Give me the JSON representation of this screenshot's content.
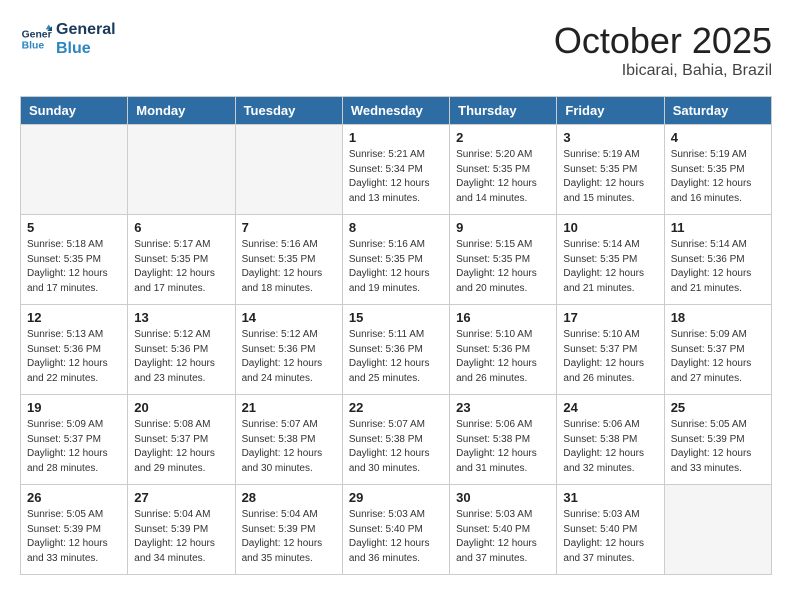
{
  "header": {
    "logo_line1": "General",
    "logo_line2": "Blue",
    "month": "October 2025",
    "location": "Ibicarai, Bahia, Brazil"
  },
  "days_of_week": [
    "Sunday",
    "Monday",
    "Tuesday",
    "Wednesday",
    "Thursday",
    "Friday",
    "Saturday"
  ],
  "weeks": [
    [
      {
        "day": "",
        "info": ""
      },
      {
        "day": "",
        "info": ""
      },
      {
        "day": "",
        "info": ""
      },
      {
        "day": "1",
        "info": "Sunrise: 5:21 AM\nSunset: 5:34 PM\nDaylight: 12 hours\nand 13 minutes."
      },
      {
        "day": "2",
        "info": "Sunrise: 5:20 AM\nSunset: 5:35 PM\nDaylight: 12 hours\nand 14 minutes."
      },
      {
        "day": "3",
        "info": "Sunrise: 5:19 AM\nSunset: 5:35 PM\nDaylight: 12 hours\nand 15 minutes."
      },
      {
        "day": "4",
        "info": "Sunrise: 5:19 AM\nSunset: 5:35 PM\nDaylight: 12 hours\nand 16 minutes."
      }
    ],
    [
      {
        "day": "5",
        "info": "Sunrise: 5:18 AM\nSunset: 5:35 PM\nDaylight: 12 hours\nand 17 minutes."
      },
      {
        "day": "6",
        "info": "Sunrise: 5:17 AM\nSunset: 5:35 PM\nDaylight: 12 hours\nand 17 minutes."
      },
      {
        "day": "7",
        "info": "Sunrise: 5:16 AM\nSunset: 5:35 PM\nDaylight: 12 hours\nand 18 minutes."
      },
      {
        "day": "8",
        "info": "Sunrise: 5:16 AM\nSunset: 5:35 PM\nDaylight: 12 hours\nand 19 minutes."
      },
      {
        "day": "9",
        "info": "Sunrise: 5:15 AM\nSunset: 5:35 PM\nDaylight: 12 hours\nand 20 minutes."
      },
      {
        "day": "10",
        "info": "Sunrise: 5:14 AM\nSunset: 5:35 PM\nDaylight: 12 hours\nand 21 minutes."
      },
      {
        "day": "11",
        "info": "Sunrise: 5:14 AM\nSunset: 5:36 PM\nDaylight: 12 hours\nand 21 minutes."
      }
    ],
    [
      {
        "day": "12",
        "info": "Sunrise: 5:13 AM\nSunset: 5:36 PM\nDaylight: 12 hours\nand 22 minutes."
      },
      {
        "day": "13",
        "info": "Sunrise: 5:12 AM\nSunset: 5:36 PM\nDaylight: 12 hours\nand 23 minutes."
      },
      {
        "day": "14",
        "info": "Sunrise: 5:12 AM\nSunset: 5:36 PM\nDaylight: 12 hours\nand 24 minutes."
      },
      {
        "day": "15",
        "info": "Sunrise: 5:11 AM\nSunset: 5:36 PM\nDaylight: 12 hours\nand 25 minutes."
      },
      {
        "day": "16",
        "info": "Sunrise: 5:10 AM\nSunset: 5:36 PM\nDaylight: 12 hours\nand 26 minutes."
      },
      {
        "day": "17",
        "info": "Sunrise: 5:10 AM\nSunset: 5:37 PM\nDaylight: 12 hours\nand 26 minutes."
      },
      {
        "day": "18",
        "info": "Sunrise: 5:09 AM\nSunset: 5:37 PM\nDaylight: 12 hours\nand 27 minutes."
      }
    ],
    [
      {
        "day": "19",
        "info": "Sunrise: 5:09 AM\nSunset: 5:37 PM\nDaylight: 12 hours\nand 28 minutes."
      },
      {
        "day": "20",
        "info": "Sunrise: 5:08 AM\nSunset: 5:37 PM\nDaylight: 12 hours\nand 29 minutes."
      },
      {
        "day": "21",
        "info": "Sunrise: 5:07 AM\nSunset: 5:38 PM\nDaylight: 12 hours\nand 30 minutes."
      },
      {
        "day": "22",
        "info": "Sunrise: 5:07 AM\nSunset: 5:38 PM\nDaylight: 12 hours\nand 30 minutes."
      },
      {
        "day": "23",
        "info": "Sunrise: 5:06 AM\nSunset: 5:38 PM\nDaylight: 12 hours\nand 31 minutes."
      },
      {
        "day": "24",
        "info": "Sunrise: 5:06 AM\nSunset: 5:38 PM\nDaylight: 12 hours\nand 32 minutes."
      },
      {
        "day": "25",
        "info": "Sunrise: 5:05 AM\nSunset: 5:39 PM\nDaylight: 12 hours\nand 33 minutes."
      }
    ],
    [
      {
        "day": "26",
        "info": "Sunrise: 5:05 AM\nSunset: 5:39 PM\nDaylight: 12 hours\nand 33 minutes."
      },
      {
        "day": "27",
        "info": "Sunrise: 5:04 AM\nSunset: 5:39 PM\nDaylight: 12 hours\nand 34 minutes."
      },
      {
        "day": "28",
        "info": "Sunrise: 5:04 AM\nSunset: 5:39 PM\nDaylight: 12 hours\nand 35 minutes."
      },
      {
        "day": "29",
        "info": "Sunrise: 5:03 AM\nSunset: 5:40 PM\nDaylight: 12 hours\nand 36 minutes."
      },
      {
        "day": "30",
        "info": "Sunrise: 5:03 AM\nSunset: 5:40 PM\nDaylight: 12 hours\nand 37 minutes."
      },
      {
        "day": "31",
        "info": "Sunrise: 5:03 AM\nSunset: 5:40 PM\nDaylight: 12 hours\nand 37 minutes."
      },
      {
        "day": "",
        "info": ""
      }
    ]
  ]
}
